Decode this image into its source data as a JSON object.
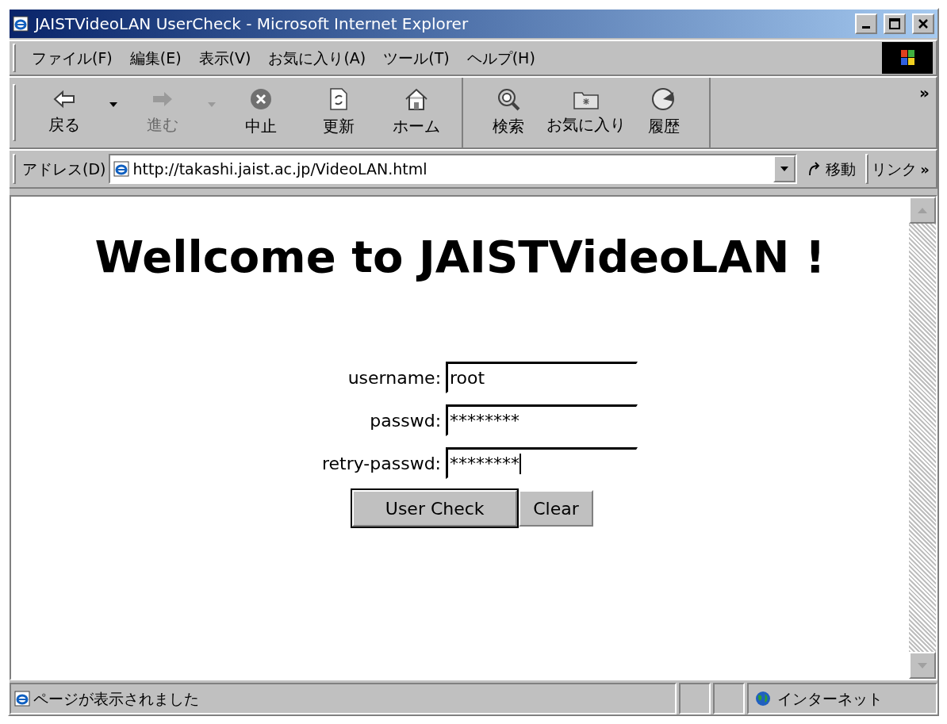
{
  "window": {
    "title": "JAISTVideoLAN UserCheck - Microsoft Internet Explorer"
  },
  "menu": [
    "ファイル(F)",
    "編集(E)",
    "表示(V)",
    "お気に入り(A)",
    "ツール(T)",
    "ヘルプ(H)"
  ],
  "toolbar": {
    "groups": [
      [
        {
          "label": "戻る",
          "kind": "back",
          "disabled": false,
          "has_dropdown": true
        },
        {
          "label": "進む",
          "kind": "forward",
          "disabled": true,
          "has_dropdown": true
        },
        {
          "label": "中止",
          "kind": "stop",
          "disabled": false,
          "has_dropdown": false
        },
        {
          "label": "更新",
          "kind": "refresh",
          "disabled": false,
          "has_dropdown": false
        },
        {
          "label": "ホーム",
          "kind": "home",
          "disabled": false,
          "has_dropdown": false
        }
      ],
      [
        {
          "label": "検索",
          "kind": "search",
          "disabled": false,
          "has_dropdown": false
        },
        {
          "label": "お気に入り",
          "kind": "favorites",
          "disabled": false,
          "has_dropdown": false
        },
        {
          "label": "履歴",
          "kind": "history",
          "disabled": false,
          "has_dropdown": false
        }
      ]
    ],
    "more": "»"
  },
  "address_bar": {
    "label": "アドレス(D)",
    "url": "http://takashi.jaist.ac.jp/VideoLAN.html",
    "go": "移動",
    "links": "リンク",
    "links_more": "»"
  },
  "page": {
    "heading": "Wellcome to JAISTVideoLAN !",
    "fields": [
      {
        "label": "username:",
        "value": "root",
        "focused": false
      },
      {
        "label": "passwd:",
        "value": "********",
        "focused": false
      },
      {
        "label": "retry-passwd:",
        "value": "********",
        "focused": true
      }
    ],
    "buttons": [
      {
        "label": "User Check",
        "default": true
      },
      {
        "label": "Clear",
        "default": false
      }
    ]
  },
  "status_bar": {
    "message": "ページが表示されました",
    "zone": "インターネット"
  }
}
